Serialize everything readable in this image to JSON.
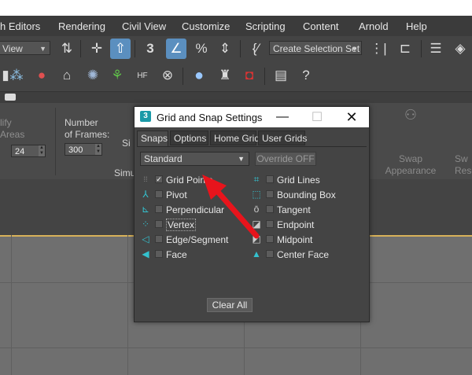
{
  "menubar": {
    "items": [
      "h Editors",
      "Rendering",
      "Civil View",
      "Customize",
      "Scripting",
      "Content",
      "Arnold",
      "Help"
    ]
  },
  "toolbar": {
    "view_dropdown": "View",
    "selection_set_placeholder": "Create Selection Set"
  },
  "ribbon": {
    "modify_areas_label_1": "lify",
    "modify_areas_label_2": "Areas",
    "modify_areas_value": "24",
    "frames_label_1": "Number",
    "frames_label_2": "of Frames:",
    "frames_value": "300",
    "section_label": "Simu",
    "si_label": "Si",
    "swap_appearance_1": "Swap",
    "swap_appearance_2": "Appearance",
    "swap_res_1": "Sw",
    "swap_res_2": "Resc"
  },
  "dialog": {
    "title": "Grid and Snap Settings",
    "tabs": [
      "Snaps",
      "Options",
      "Home Grid",
      "User Grids"
    ],
    "active_tab": "Snaps",
    "preset_dropdown": "Standard",
    "override_button": "Override OFF",
    "snaps_left": [
      {
        "label": "Grid Points",
        "checked": true,
        "icon": "grid-points-icon"
      },
      {
        "label": "Pivot",
        "checked": false,
        "icon": "pivot-icon"
      },
      {
        "label": "Perpendicular",
        "checked": false,
        "icon": "perpendicular-icon"
      },
      {
        "label": "Vertex",
        "checked": false,
        "icon": "vertex-icon"
      },
      {
        "label": "Edge/Segment",
        "checked": false,
        "icon": "edge-segment-icon"
      },
      {
        "label": "Face",
        "checked": false,
        "icon": "face-icon"
      }
    ],
    "snaps_right": [
      {
        "label": "Grid Lines",
        "checked": false,
        "icon": "grid-lines-icon"
      },
      {
        "label": "Bounding Box",
        "checked": false,
        "icon": "bounding-box-icon"
      },
      {
        "label": "Tangent",
        "checked": false,
        "icon": "tangent-icon"
      },
      {
        "label": "Endpoint",
        "checked": false,
        "icon": "endpoint-icon"
      },
      {
        "label": "Midpoint",
        "checked": false,
        "icon": "midpoint-icon"
      },
      {
        "label": "Center Face",
        "checked": false,
        "icon": "center-face-icon"
      }
    ],
    "clear_all_button": "Clear All"
  },
  "annotation": {
    "color": "#e8141c",
    "icon": "red-arrow-pointer"
  },
  "colors": {
    "accent": "#5b8fbf",
    "snap_icon": "#34c1ce",
    "viewport_border": "#d8b25a"
  }
}
